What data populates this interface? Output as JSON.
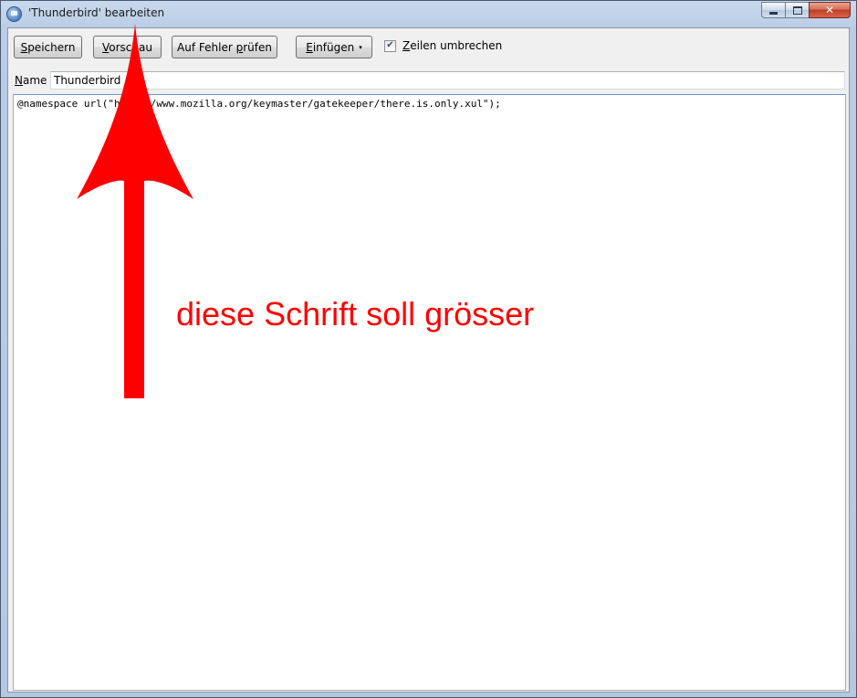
{
  "window": {
    "title": "'Thunderbird' bearbeiten",
    "close_glyph": "✕"
  },
  "toolbar": {
    "save": {
      "ul": "S",
      "rest": "peichern"
    },
    "preview": {
      "ul": "V",
      "rest": "orschau"
    },
    "check_errors": {
      "pre": "Auf Fehler ",
      "ul": "p",
      "rest": "rüfen"
    },
    "insert": {
      "ul": "E",
      "rest": "infügen",
      "arrow": "▾"
    },
    "wrap_lines": {
      "ul": "Z",
      "rest": "eilen umbrechen",
      "checked": true,
      "check_glyph": "✔"
    }
  },
  "name_field": {
    "label_ul": "N",
    "label_rest": "ame",
    "value": "Thunderbird"
  },
  "editor": {
    "code": "@namespace url(\"http://www.mozilla.org/keymaster/gatekeeper/there.is.only.xul\");"
  },
  "annotation": {
    "text": "diese Schrift soll grösser",
    "color": "#ff0000",
    "arrow_icon": "up-arrow-icon"
  },
  "colors": {
    "accent": "#ff0000",
    "window_frame": "#b9cde6",
    "client_bg": "#f0f0f0"
  }
}
